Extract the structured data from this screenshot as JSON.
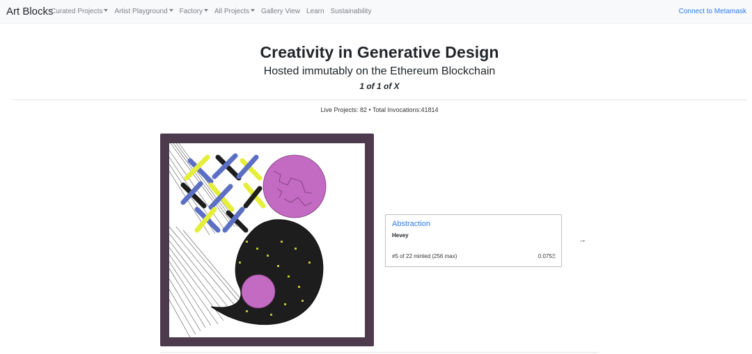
{
  "navbar": {
    "brand": "Art Blocks",
    "items": [
      {
        "label": "Curated Projects",
        "dropdown": true
      },
      {
        "label": "Artist Playground",
        "dropdown": true
      },
      {
        "label": "Factory",
        "dropdown": true
      },
      {
        "label": "All Projects",
        "dropdown": true
      },
      {
        "label": "Gallery View",
        "dropdown": false
      },
      {
        "label": "Learn",
        "dropdown": false
      },
      {
        "label": "Sustainability",
        "dropdown": false
      }
    ],
    "connect_label": "Connect to Metamask"
  },
  "hero": {
    "title": "Creativity in Generative Design",
    "subtitle": "Hosted immutably on the Ethereum Blockchain",
    "tagline": "1 of 1 of X"
  },
  "stats": "Live Projects: 82 • Total Invocations:41814",
  "project": {
    "title": "Abstraction",
    "artist": "Hevey",
    "minted": "#5 of 22 minted (256 max)",
    "price": "0.075Ξ",
    "next_icon": "arrow-right-icon",
    "next_glyph": "→"
  },
  "colors": {
    "accent": "#2b7de9",
    "frame": "#4d3b4d",
    "art_magenta": "#c36ac2",
    "art_yellow": "#e6ee3c",
    "art_blue": "#5b6fc4",
    "art_dark": "#1a1a1a"
  }
}
